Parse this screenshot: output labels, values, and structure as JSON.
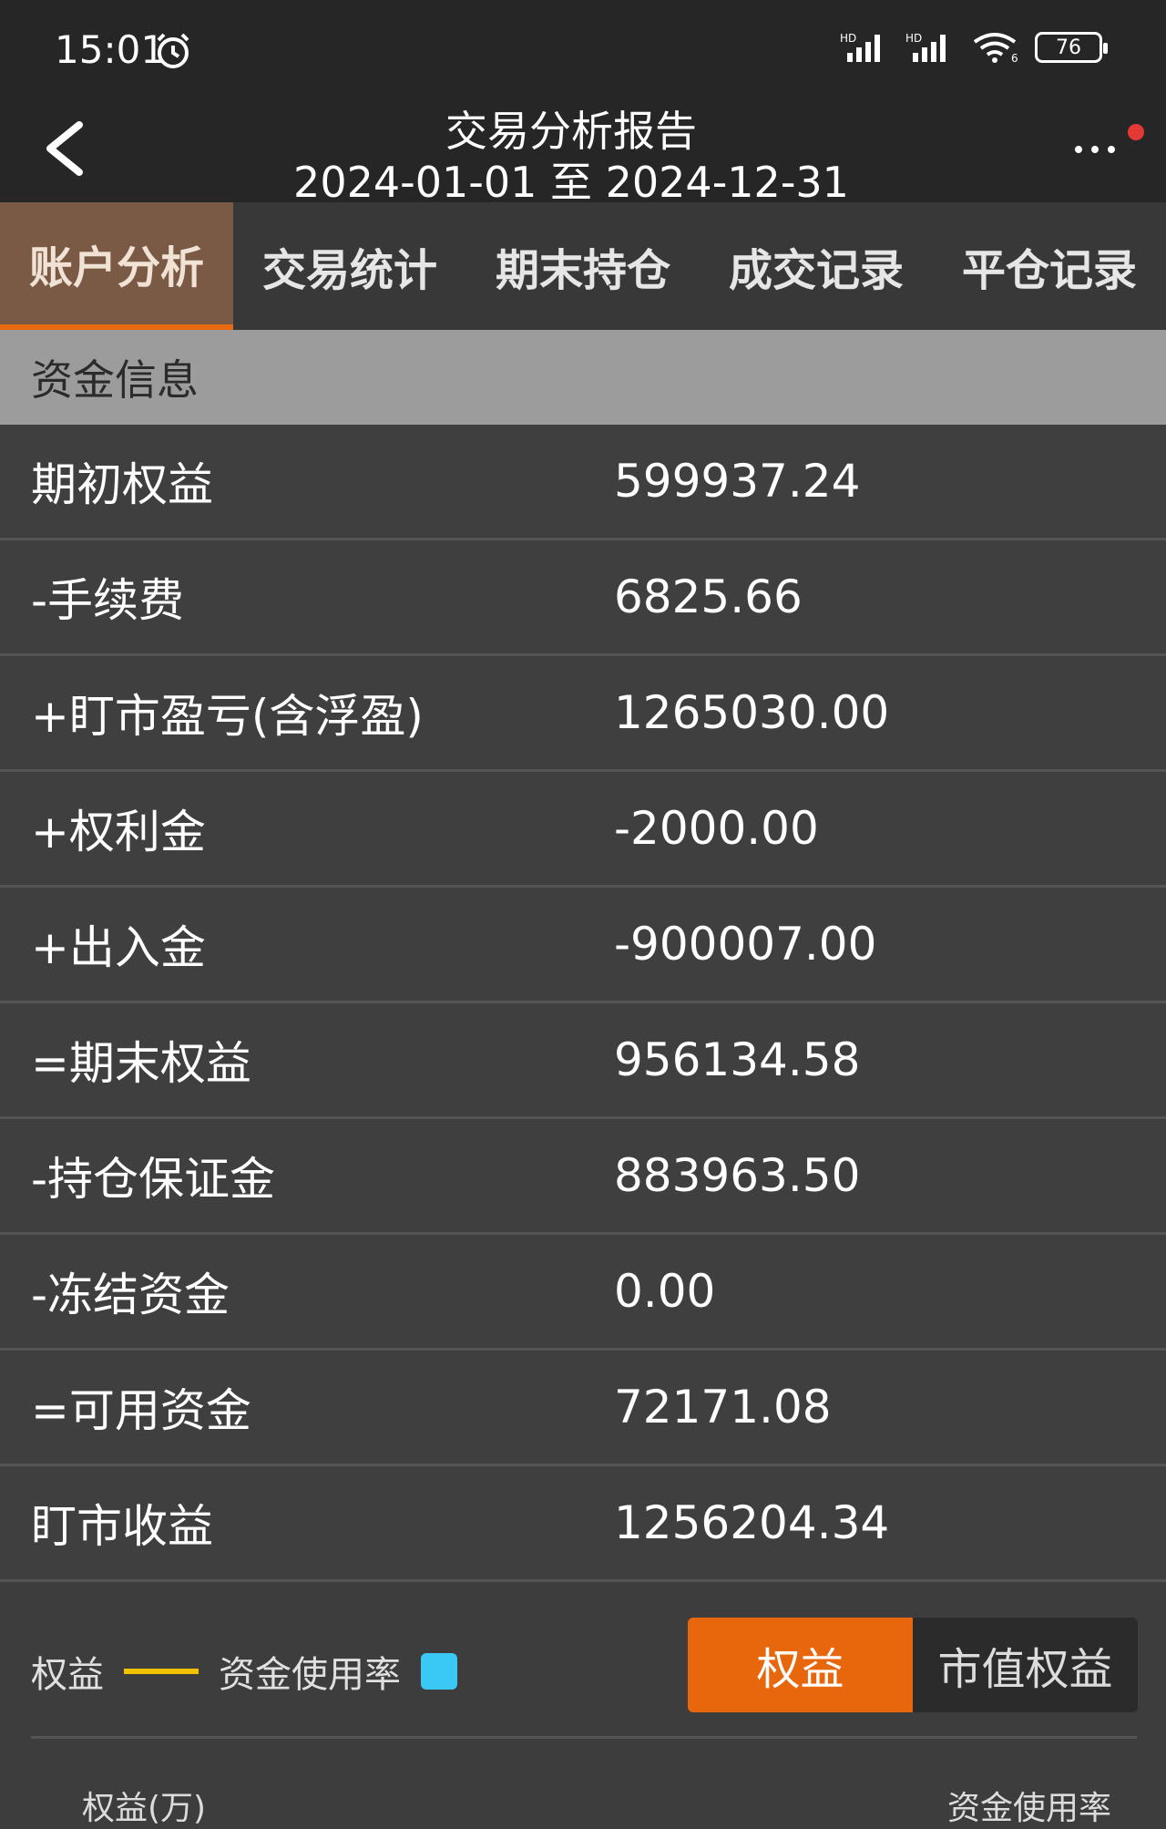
{
  "status_bar": {
    "time": "15:01",
    "network": "HD",
    "wifi_badge": "6",
    "battery": "76"
  },
  "header": {
    "title": "交易分析报告",
    "date_range": "2024-01-01 至 2024-12-31"
  },
  "tabs": [
    {
      "label": "账户分析",
      "active": true
    },
    {
      "label": "交易统计",
      "active": false
    },
    {
      "label": "期末持仓",
      "active": false
    },
    {
      "label": "成交记录",
      "active": false
    },
    {
      "label": "平仓记录",
      "active": false
    }
  ],
  "section": {
    "title": "资金信息"
  },
  "fund_rows": [
    {
      "label": "期初权益",
      "value": "599937.24"
    },
    {
      "label": "-手续费",
      "value": "6825.66"
    },
    {
      "label": "+盯市盈亏(含浮盈)",
      "value": "1265030.00"
    },
    {
      "label": "+权利金",
      "value": "-2000.00"
    },
    {
      "label": "+出入金",
      "value": "-900007.00"
    },
    {
      "label": "=期末权益",
      "value": "956134.58"
    },
    {
      "label": "-持仓保证金",
      "value": "883963.50"
    },
    {
      "label": "-冻结资金",
      "value": "0.00"
    },
    {
      "label": "=可用资金",
      "value": "72171.08"
    },
    {
      "label": "盯市收益",
      "value": "1256204.34"
    }
  ],
  "chart_controls": {
    "legend_equity": "权益",
    "legend_usage": "资金使用率",
    "toggle_equity": "权益",
    "toggle_market_equity": "市值权益",
    "axis_left": "权益(万)",
    "axis_right": "资金使用率"
  },
  "colors": {
    "accent": "#e8660c",
    "active_tab_bg": "#7a5a45",
    "equity_line": "#f2c200",
    "usage_square": "#3ac9f5"
  }
}
